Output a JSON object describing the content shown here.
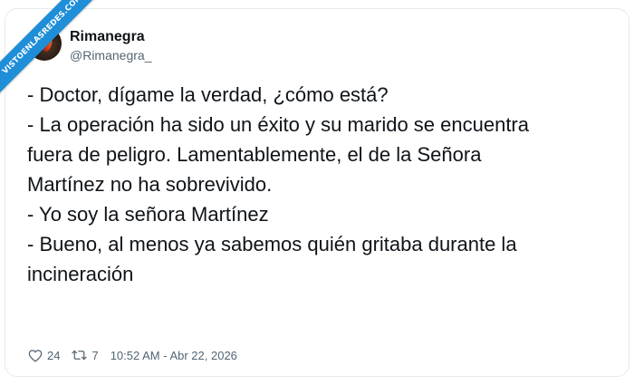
{
  "watermark": "VISTOENLASREDES.COM",
  "author": {
    "name": "Rimanegra",
    "handle": "@Rimanegra_"
  },
  "tweet": {
    "lines": [
      "- Doctor, dígame la verdad, ¿cómo está?",
      "- La operación ha sido un éxito y su marido se encuentra",
      "fuera de peligro. Lamentablemente, el de la Señora",
      "Martínez no ha sobrevivido.",
      "- Yo soy la señora Martínez",
      "- Bueno, al menos ya sabemos quién gritaba durante la",
      "incineración"
    ]
  },
  "footer": {
    "likes": "24",
    "retweets": "7",
    "timestamp": "10:52 AM - Abr 22, 2026",
    "like_icon": "heart-icon",
    "retweet_icon": "retweet-icon"
  },
  "colors": {
    "ribbon": "#1f8ed8",
    "text": "#0f1419",
    "muted": "#536471",
    "border": "#e6e9ed"
  }
}
